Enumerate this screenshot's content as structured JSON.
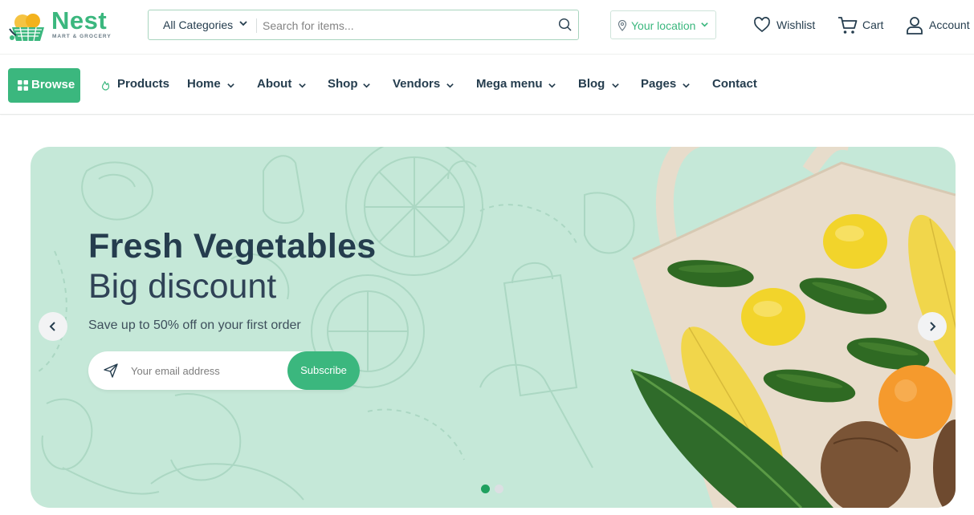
{
  "brand": {
    "name": "Nest",
    "tagline": "MART & GROCERY",
    "color": "#3bb77e"
  },
  "search": {
    "category_label": "All Categories",
    "placeholder": "Search for items..."
  },
  "location": {
    "label": "Your location"
  },
  "header_actions": {
    "wishlist": "Wishlist",
    "cart": "Cart",
    "account": "Account"
  },
  "nav": {
    "browse": "Browse",
    "items": [
      {
        "label": "Products",
        "icon": "flame-icon",
        "dropdown": false
      },
      {
        "label": "Home",
        "dropdown": true
      },
      {
        "label": "About",
        "dropdown": true
      },
      {
        "label": "Shop",
        "dropdown": true
      },
      {
        "label": "Vendors",
        "dropdown": true
      },
      {
        "label": "Mega menu",
        "dropdown": true
      },
      {
        "label": "Blog",
        "dropdown": true
      },
      {
        "label": "Pages",
        "dropdown": true
      },
      {
        "label": "Contact",
        "dropdown": false
      }
    ]
  },
  "hero": {
    "title_line1": "Fresh Vegetables",
    "title_line2": "Big discount",
    "subtitle": "Save up to 50% off on your first order",
    "email_placeholder": "Your email address",
    "subscribe_label": "Subscribe",
    "background": "#c5e8d8",
    "slides_total": 2,
    "active_slide": 1
  },
  "colors": {
    "accent": "#3bb77e",
    "heading": "#253d4e",
    "dot_inactive": "#dcdfe3",
    "dot_active": "#1fa05f"
  }
}
